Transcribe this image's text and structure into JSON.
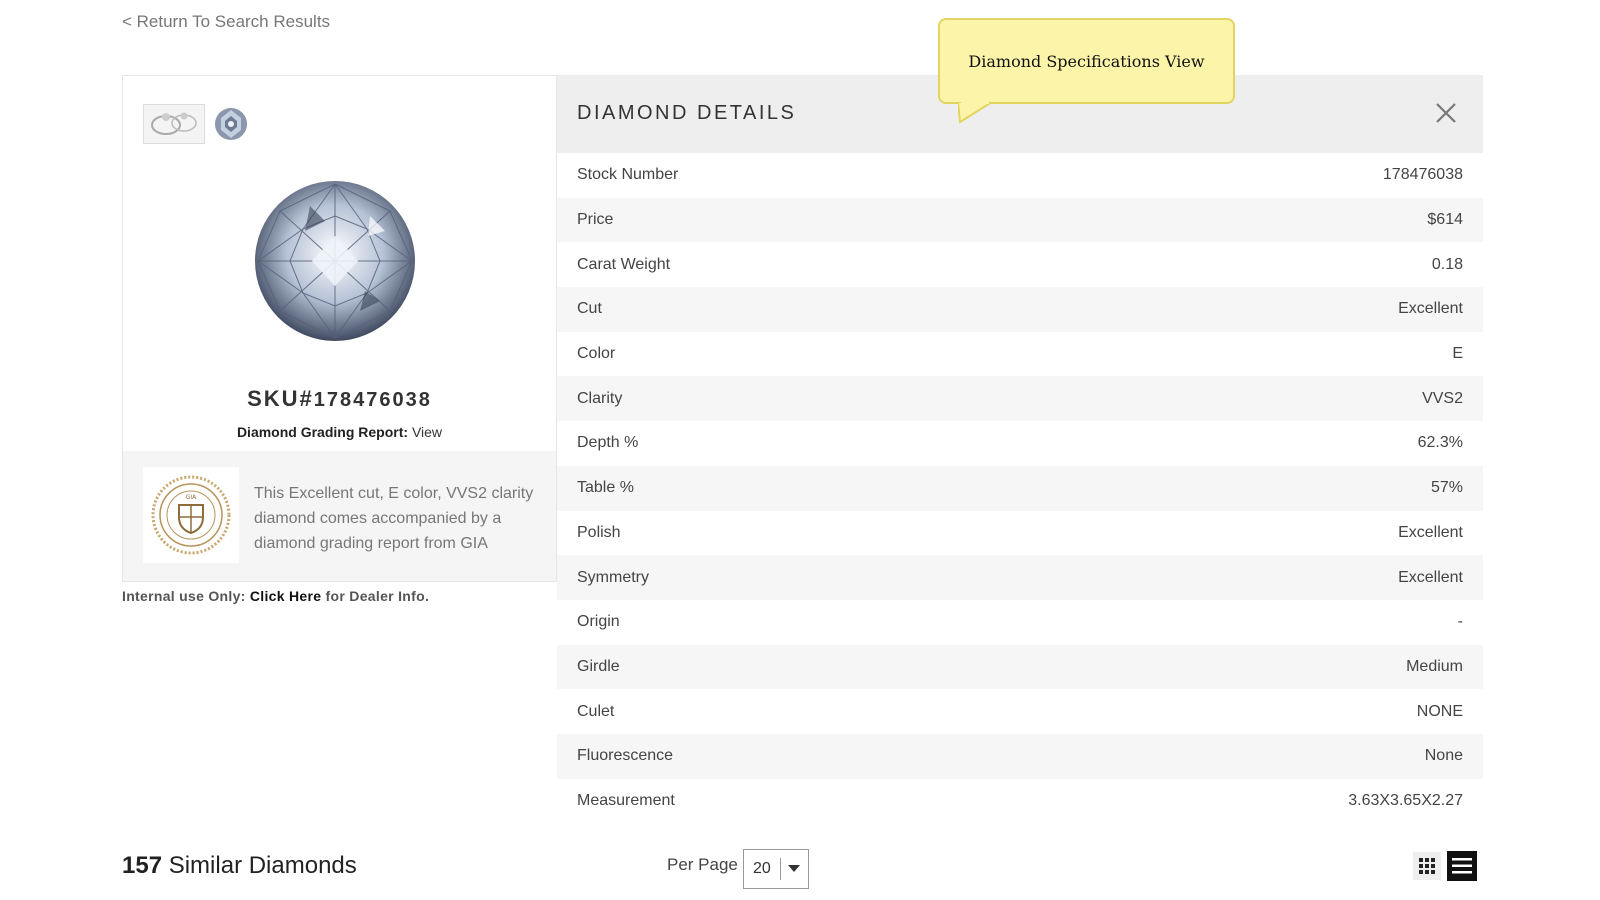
{
  "nav": {
    "back_label": "< Return To Search Results"
  },
  "product": {
    "sku_prefix": "SKU#",
    "sku_number": "178476038",
    "grading_label": "Diamond Grading Report:",
    "grading_link": "View",
    "cert_description": "This Excellent cut, E color, VVS2 clarity diamond comes accompanied by a diamond grading report from GIA",
    "seal_text": "GIA"
  },
  "internal": {
    "prefix": "Internal use Only:",
    "link": "Click Here",
    "suffix": "for Dealer Info."
  },
  "details": {
    "title": "DIAMOND DETAILS",
    "rows": [
      {
        "label": "Stock Number",
        "value": "178476038"
      },
      {
        "label": "Price",
        "value": "$614"
      },
      {
        "label": "Carat Weight",
        "value": "0.18"
      },
      {
        "label": "Cut",
        "value": "Excellent"
      },
      {
        "label": "Color",
        "value": "E"
      },
      {
        "label": "Clarity",
        "value": "VVS2"
      },
      {
        "label": "Depth %",
        "value": "62.3%"
      },
      {
        "label": "Table %",
        "value": "57%"
      },
      {
        "label": "Polish",
        "value": "Excellent"
      },
      {
        "label": "Symmetry",
        "value": "Excellent"
      },
      {
        "label": "Origin",
        "value": "-"
      },
      {
        "label": "Girdle",
        "value": "Medium"
      },
      {
        "label": "Culet",
        "value": "NONE"
      },
      {
        "label": "Fluorescence",
        "value": "None"
      },
      {
        "label": "Measurement",
        "value": "3.63X3.65X2.27"
      }
    ]
  },
  "tooltip": {
    "text": "Diamond Specifications View"
  },
  "footer": {
    "similar_count": "157",
    "similar_label": "Similar Diamonds",
    "per_page_label": "Per Page",
    "per_page_value": "20"
  },
  "icons": {
    "close": "close-icon",
    "grid_view": "grid-view-icon",
    "list_view": "list-view-icon",
    "dropdown": "chevron-down-icon"
  },
  "colors": {
    "tooltip_bg": "#fcf5a9",
    "header_bg": "#eeeeee",
    "list_view_active": "#111111"
  }
}
